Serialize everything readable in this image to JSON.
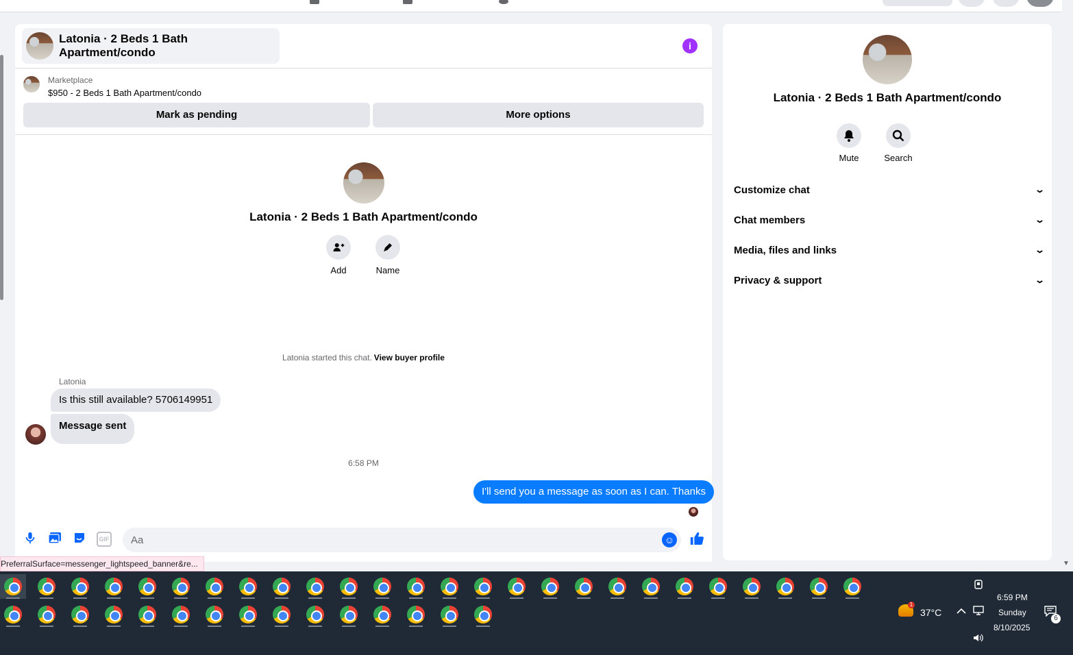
{
  "chat": {
    "title": "Latonia · 2 Beds 1 Bath Apartment/condo",
    "marketplace_label": "Marketplace",
    "listing": "$950 - 2 Beds 1 Bath Apartment/condo",
    "mark_pending": "Mark as pending",
    "more_options": "More options",
    "profile_name": "Latonia · 2 Beds 1 Bath Apartment/condo",
    "actions": [
      {
        "label": "Add",
        "icon": "add-person-icon"
      },
      {
        "label": "Name",
        "icon": "pencil-icon"
      }
    ],
    "started_text": "Latonia started this chat.",
    "view_buyer": "View buyer profile",
    "sender": "Latonia",
    "messages_in": [
      "Is this still available? 5706149951",
      "Message sent"
    ],
    "timestamp": "6:58 PM",
    "message_out": "I'll send you a message as soon as I can. Thanks",
    "composer_placeholder": "Aa"
  },
  "url_tooltip": "PreferralSurface=messenger_lightspeed_banner&re...",
  "details": {
    "name": "Latonia · 2 Beds 1 Bath Apartment/condo",
    "actions": [
      {
        "label": "Mute",
        "icon": "bell-icon"
      },
      {
        "label": "Search",
        "icon": "search-icon"
      }
    ],
    "sections": [
      "Customize chat",
      "Chat members",
      "Media, files and links",
      "Privacy & support"
    ]
  },
  "taskbar": {
    "weather_temp": "37°C",
    "weather_alert": "1",
    "time": "6:59 PM",
    "day": "Sunday",
    "date": "8/10/2025",
    "notifications": "6",
    "row1_app_count": 26,
    "row2_app_count": 15
  },
  "colors": {
    "accent": "#0866ff",
    "outgoing_bubble": "#0a7cff",
    "info_purple": "#a033ff",
    "taskbar": "#1f2a36"
  }
}
